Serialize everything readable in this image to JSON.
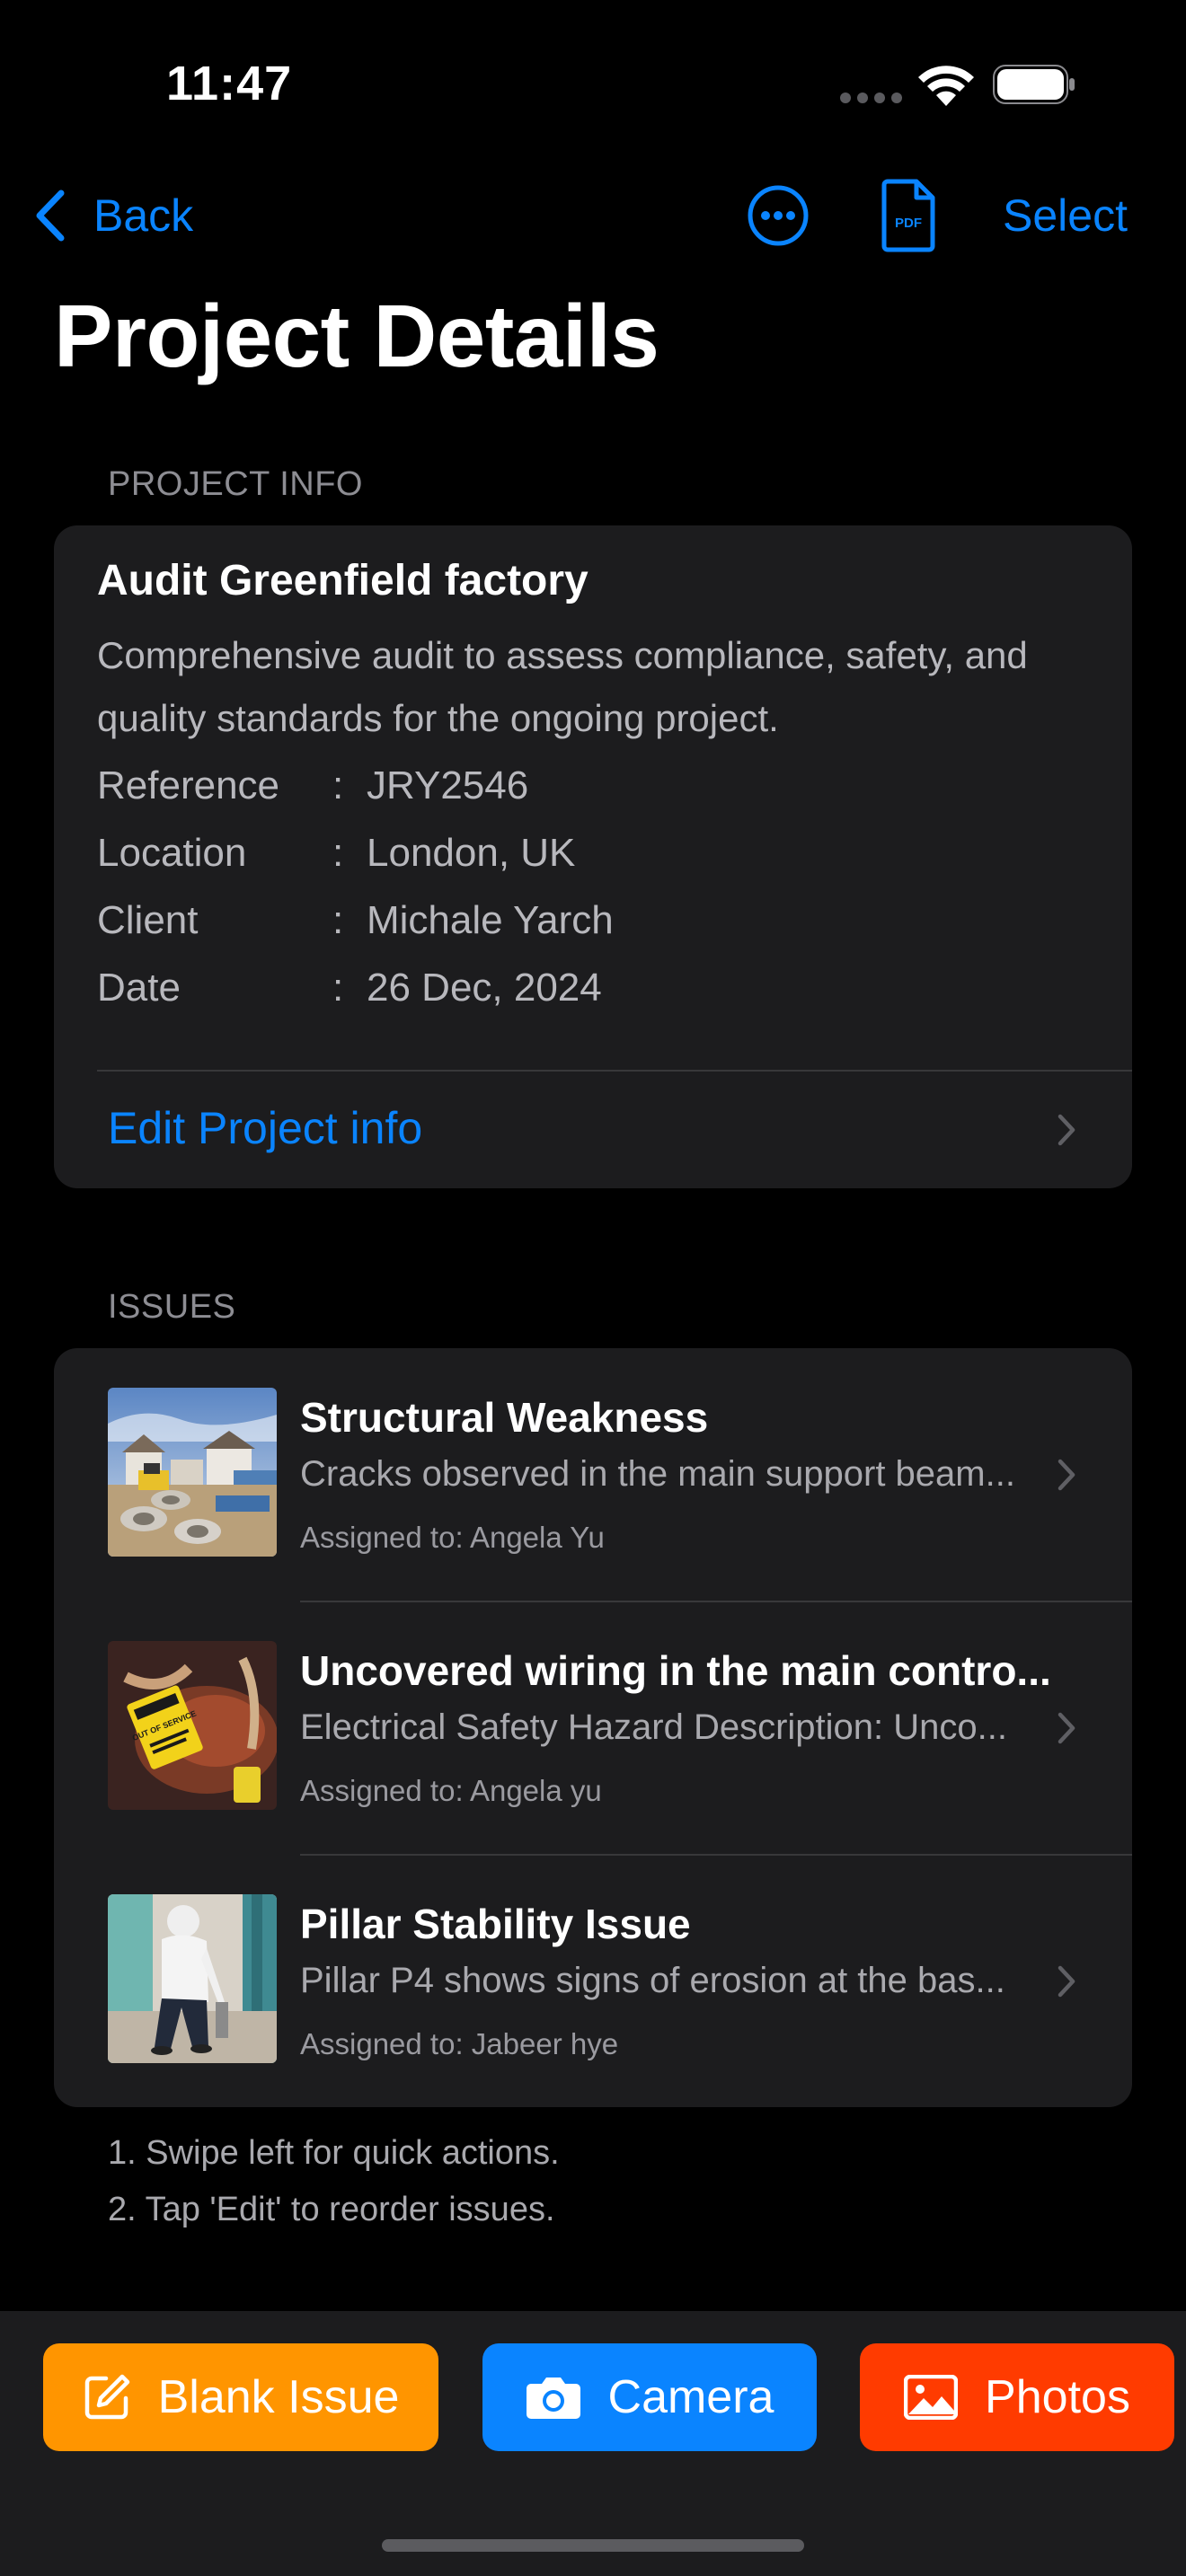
{
  "status_bar": {
    "time": "11:47"
  },
  "nav": {
    "back_label": "Back",
    "select_label": "Select",
    "pdf_badge": "PDF"
  },
  "page_title": "Project Details",
  "project_info": {
    "section_header": "PROJECT INFO",
    "title": "Audit Greenfield factory",
    "description": "Comprehensive audit to assess compliance, safety, and quality standards for the ongoing project.",
    "fields": [
      {
        "label": "Reference",
        "value": "JRY2546"
      },
      {
        "label": "Location",
        "value": "London, UK"
      },
      {
        "label": "Client",
        "value": "Michale Yarch"
      },
      {
        "label": "Date",
        "value": "26 Dec, 2024"
      }
    ],
    "separator": ":",
    "edit_label": "Edit Project info"
  },
  "issues": {
    "section_header": "ISSUES",
    "items": [
      {
        "title": "Structural Weakness",
        "description": "Cracks observed in the main support beam...",
        "assigned": "Assigned to: Angela Yu",
        "thumb_label": ""
      },
      {
        "title": "Uncovered wiring in the main contro...",
        "description": "Electrical Safety Hazard Description: Unco...",
        "assigned": "Assigned to: Angela yu",
        "thumb_label": "OUT OF SERVICE"
      },
      {
        "title": "Pillar Stability Issue",
        "description": "Pillar P4 shows signs of erosion at the bas...",
        "assigned": "Assigned to: Jabeer hye",
        "thumb_label": ""
      }
    ]
  },
  "hints": [
    "1. Swipe left for quick actions.",
    "2. Tap 'Edit' to reorder issues."
  ],
  "toolbar": {
    "blank_issue": "Blank Issue",
    "camera": "Camera",
    "photos": "Photos"
  },
  "colors": {
    "accent": "#0a84ff",
    "blank_button": "#ff9500",
    "camera_button": "#0a84ff",
    "photos_button": "#ff3b00",
    "card": "#1c1c1e",
    "background": "#000000"
  },
  "icons": [
    "chevron-left-icon",
    "ellipsis-circle-icon",
    "pdf-document-icon",
    "chevron-right-icon",
    "compose-icon",
    "camera-icon",
    "photo-icon",
    "wifi-icon",
    "battery-icon"
  ]
}
